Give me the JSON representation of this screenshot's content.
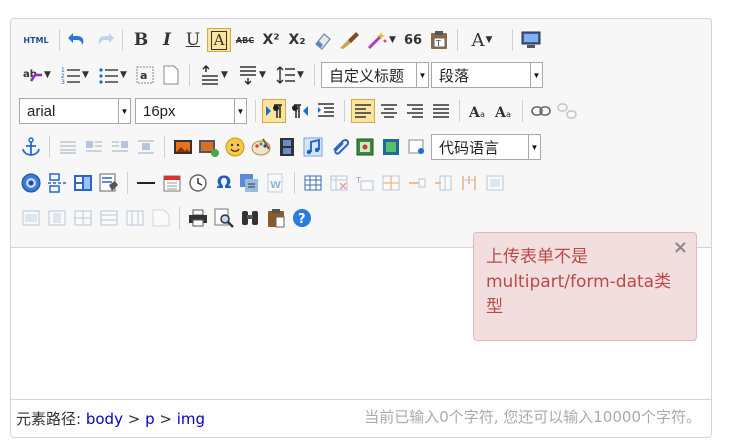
{
  "toolbar": {
    "html_label": "HTML",
    "bold": "B",
    "italic": "I",
    "underline": "U",
    "fontborder": "A",
    "strike": "ABC",
    "superscript": "X²",
    "subscript": "X₂",
    "quote": "66",
    "forecolor": "A",
    "font_family": "arial",
    "font_size": "16px",
    "custom_title": "自定义标题",
    "paragraph": "段落",
    "code_language": "代码语言",
    "omega": "Ω"
  },
  "toast": {
    "message": "上传表单不是multipart/form-data类型",
    "close": "×"
  },
  "status": {
    "path_label": "元素路径:",
    "path": [
      "body",
      "p",
      "img"
    ],
    "separator": " > ",
    "count_text": "当前已输入0个字符, 您还可以输入10000个字符。"
  },
  "colors": {
    "toolbar_bg": "#f7f7f7",
    "active_bg": "#fbe49b",
    "toast_bg": "#f2dede",
    "toast_text": "#b94a48",
    "link": "#0000cc"
  }
}
